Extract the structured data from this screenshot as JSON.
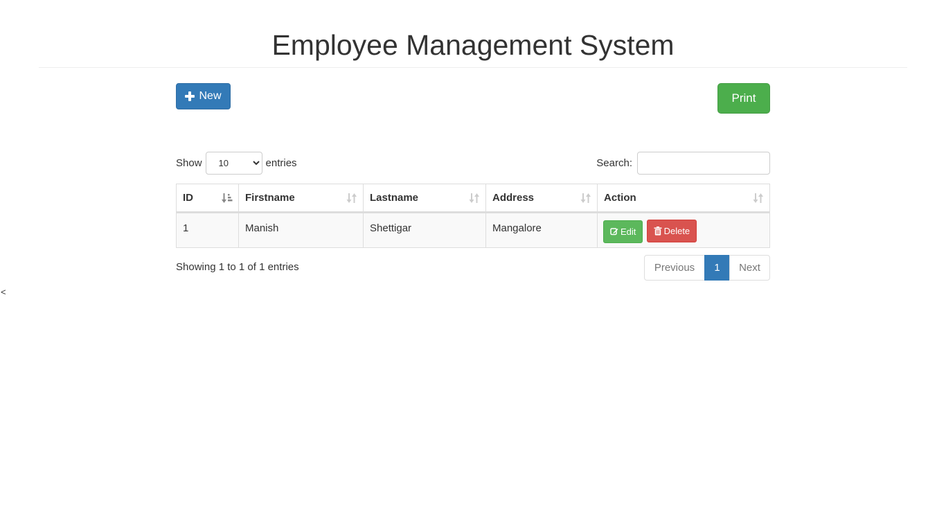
{
  "header": {
    "title": "Employee Management System"
  },
  "toolbar": {
    "new_label": "New",
    "print_label": "Print"
  },
  "length": {
    "show_label": "Show",
    "selected": "10",
    "options": [
      "10"
    ],
    "entries_label": "entries"
  },
  "search": {
    "label": "Search:",
    "value": "",
    "placeholder": ""
  },
  "table": {
    "columns": [
      "ID",
      "Firstname",
      "Lastname",
      "Address",
      "Action"
    ],
    "rows": [
      {
        "id": "1",
        "firstname": "Manish",
        "lastname": "Shettigar",
        "address": "Mangalore"
      }
    ],
    "edit_label": "Edit",
    "delete_label": "Delete"
  },
  "footer": {
    "info": "Showing 1 to 1 of 1 entries",
    "previous": "Previous",
    "page": "1",
    "next": "Next"
  },
  "stray_text": "<",
  "colors": {
    "primary": "#337ab7",
    "success": "#5cb85c",
    "danger": "#d9534f"
  },
  "icons": [
    "plus-icon",
    "edit-icon",
    "trash-icon",
    "sort-asc-icon",
    "sort-both-icon"
  ]
}
